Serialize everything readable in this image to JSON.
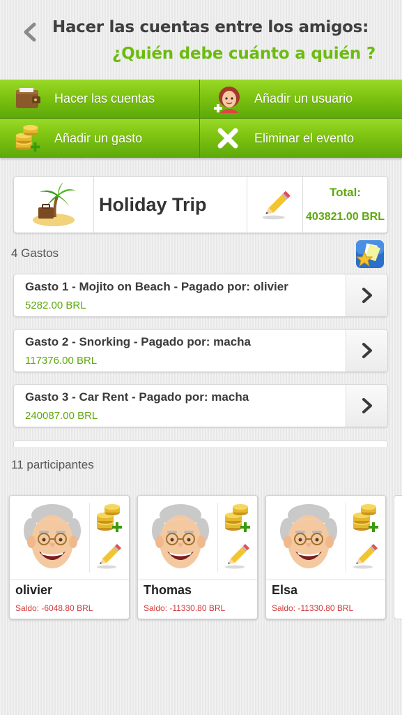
{
  "header": {
    "title_line1": "Hacer las cuentas entre los amigos:",
    "title_line2": "¿Quién debe cuánto a quién ?"
  },
  "actions": {
    "settle": "Hacer las cuentas",
    "add_user": "Añadir un usuario",
    "add_expense": "Añadir un gasto",
    "delete_event": "Eliminar el evento"
  },
  "event": {
    "name": "Holiday Trip",
    "total_label": "Total:",
    "total_value": "403821.00 BRL"
  },
  "expenses": {
    "count_label": "4 Gastos",
    "items": [
      {
        "title": "Gasto 1 - Mojito on Beach - Pagado por: olivier",
        "amount": "5282.00 BRL"
      },
      {
        "title": "Gasto 2 - Snorking - Pagado por: macha",
        "amount": "117376.00 BRL"
      },
      {
        "title": "Gasto 3 - Car Rent - Pagado por: macha",
        "amount": "240087.00 BRL"
      }
    ]
  },
  "participants": {
    "count_label": "11 participantes",
    "items": [
      {
        "name": "olivier",
        "saldo": "Saldo: -6048.80 BRL"
      },
      {
        "name": "Thomas",
        "saldo": "Saldo: -11330.80 BRL"
      },
      {
        "name": "Elsa",
        "saldo": "Saldo: -11330.80 BRL"
      }
    ]
  },
  "colors": {
    "accent_green": "#6cbb10",
    "negative_red": "#d2393a"
  }
}
